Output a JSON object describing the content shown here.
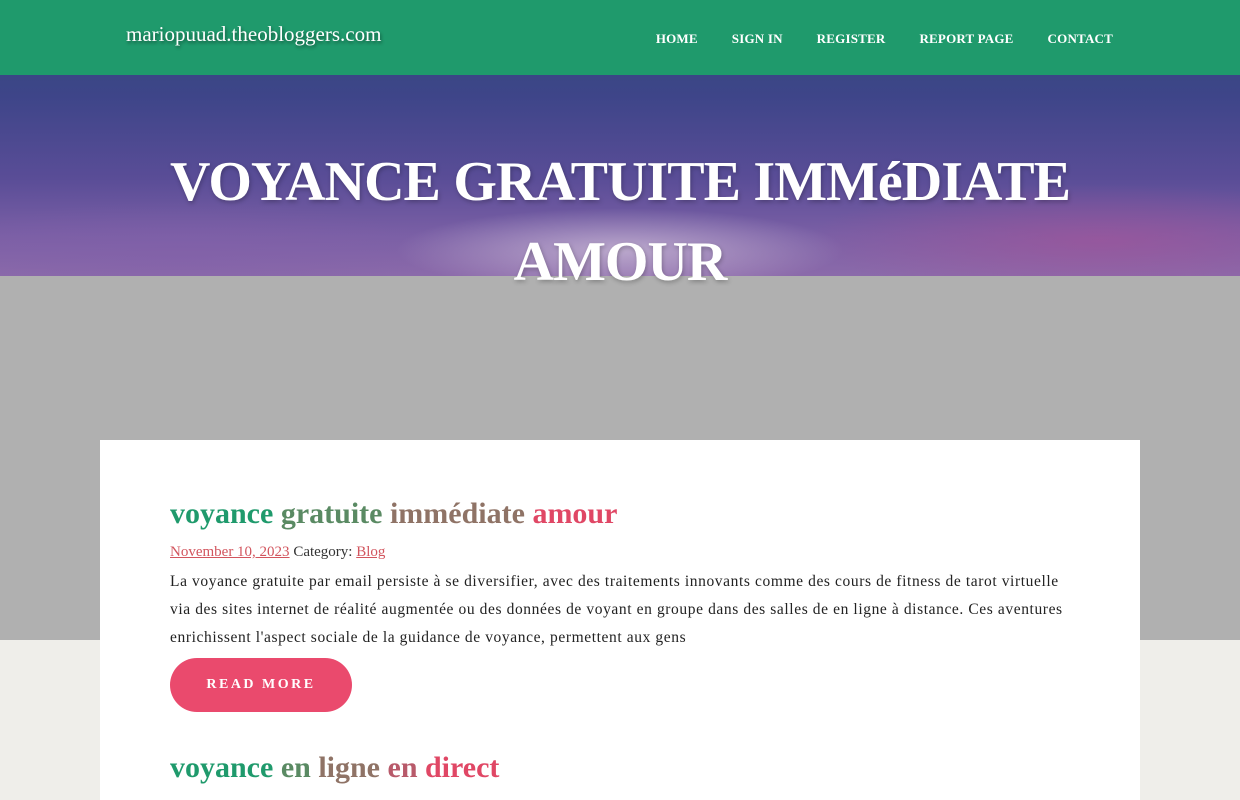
{
  "header": {
    "site_title": "mariopuuad.theobloggers.com",
    "nav": [
      "HOME",
      "SIGN IN",
      "REGISTER",
      "REPORT PAGE",
      "CONTACT"
    ]
  },
  "hero": {
    "title": "VOYANCE GRATUITE IMMéDIATE AMOUR"
  },
  "posts": [
    {
      "title_words": [
        "voyance",
        "gratuite",
        "immédiate",
        "amour"
      ],
      "date": "November 10, 2023",
      "category_label": "Category:",
      "category": "Blog",
      "excerpt": "La voyance gratuite par email persiste à se diversifier, avec des traitements innovants comme des cours de fitness de tarot virtuelle via des sites internet de réalité augmentée ou des données de voyant en groupe dans des salles de en ligne à distance. Ces aventures enrichissent l'aspect sociale de la guidance de voyance, permettent aux gens",
      "read_more": "READ MORE"
    },
    {
      "title_words": [
        "voyance",
        "en",
        "ligne",
        "en",
        "direct"
      ]
    }
  ],
  "colors": {
    "header_bg": "#1f9a6c",
    "accent_pink": "#ea4a6d",
    "link_red": "#d2555e",
    "grey_band": "#b0b0b0"
  }
}
